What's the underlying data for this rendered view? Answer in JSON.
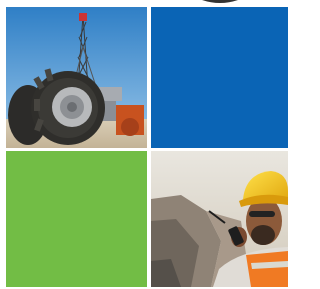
{
  "tiles": {
    "top_left": {
      "icon": "oil-rig-truck-photo"
    },
    "top_right": {
      "color": "#0a64b5"
    },
    "bottom_left": {
      "color": "#72bd45"
    },
    "bottom_right": {
      "icon": "hardhat-worker-radio-photo"
    }
  },
  "colors": {
    "blue": "#0a64b5",
    "green": "#72bd45",
    "sky": "#5a9fd6",
    "hardhat": "#f3c21c"
  }
}
